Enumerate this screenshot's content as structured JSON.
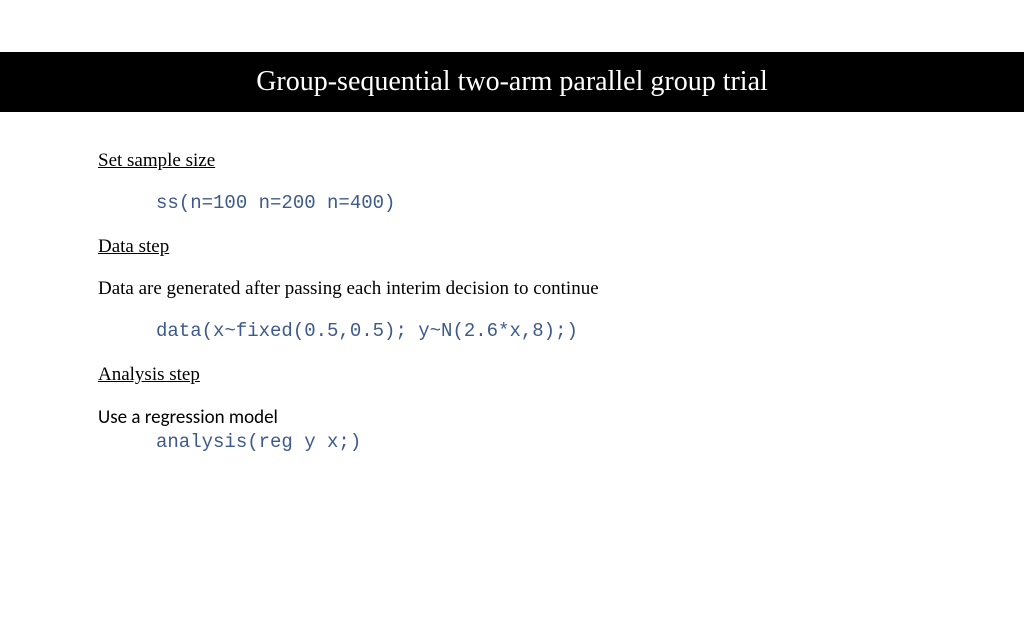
{
  "title": "Group-sequential two-arm parallel group trial",
  "sections": {
    "sampleSize": {
      "heading": "Set sample size",
      "code": "ss(n=100 n=200 n=400)"
    },
    "dataStep": {
      "heading": "Data step",
      "body": "Data are generated after passing each interim decision to continue",
      "code": "data(x~fixed(0.5,0.5); y~N(2.6*x,8);)"
    },
    "analysisStep": {
      "heading": "Analysis step",
      "body": "Use a regression model",
      "code": "analysis(reg y x;)"
    }
  }
}
